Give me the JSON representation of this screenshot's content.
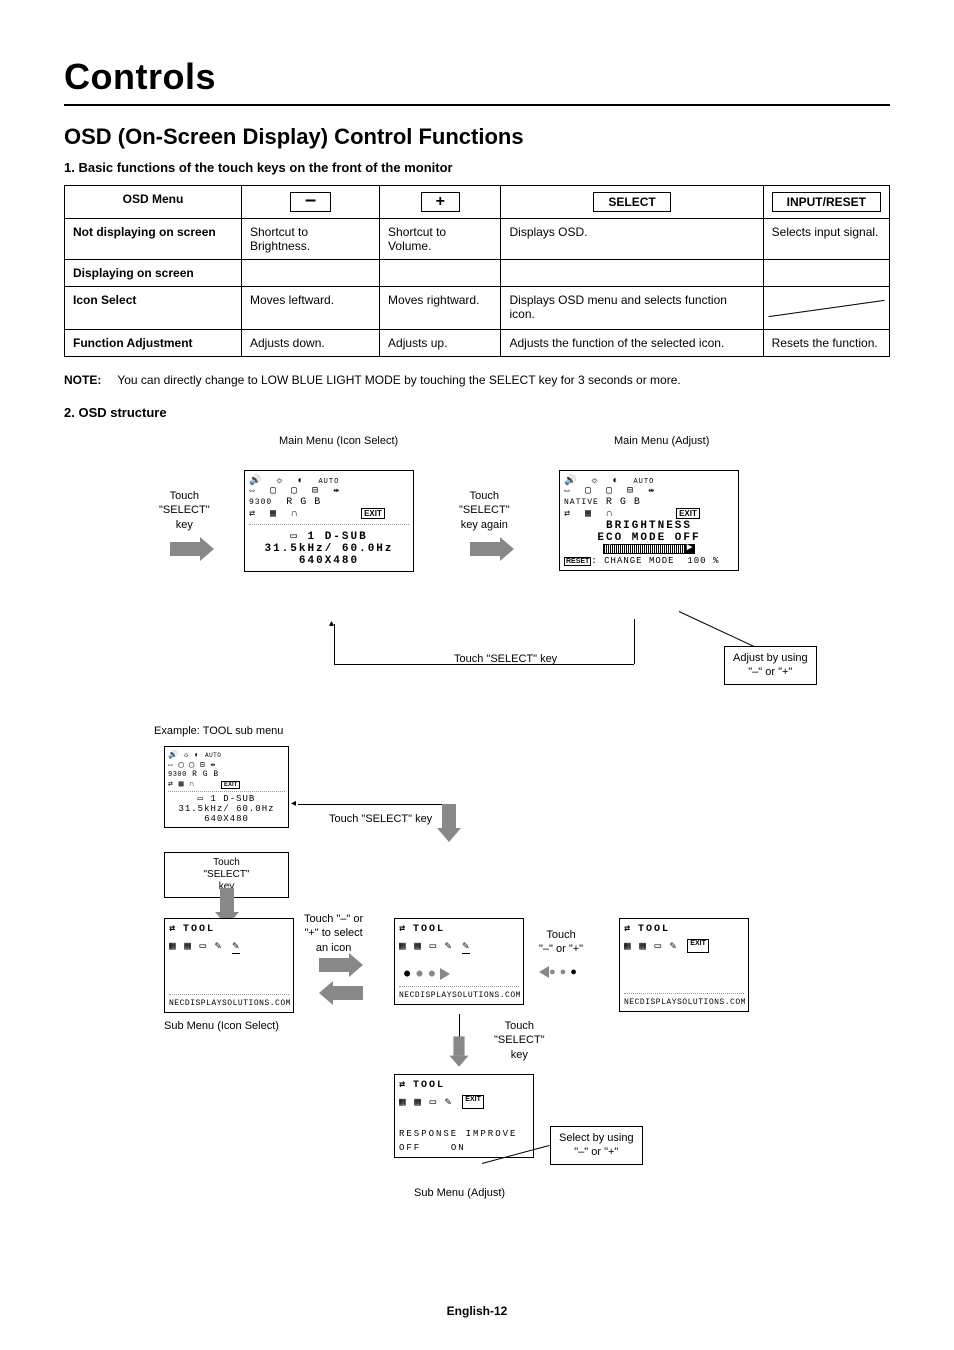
{
  "doc_title": "Controls",
  "section_title": "OSD (On-Screen Display) Control Functions",
  "sub1": "1. Basic functions of the touch keys on the front of the monitor",
  "table": {
    "headers": {
      "c0": "OSD Menu",
      "c1_sym": "–",
      "c2_sym": "+",
      "c3": "SELECT",
      "c4": "INPUT/RESET"
    },
    "rows": [
      {
        "head": "Not displaying on screen",
        "c1": "Shortcut to Brightness.",
        "c2": "Shortcut to Volume.",
        "c3": "Displays OSD.",
        "c4": "Selects input signal."
      },
      {
        "head": "Displaying on screen",
        "c1": "",
        "c2": "",
        "c3": "",
        "c4": ""
      },
      {
        "head": "Icon Select",
        "c1": "Moves leftward.",
        "c2": "Moves rightward.",
        "c3": "Displays OSD menu and selects function icon.",
        "c4": "__DIAGONAL__"
      },
      {
        "head": "Function Adjustment",
        "c1": "Adjusts down.",
        "c2": "Adjusts up.",
        "c3": "Adjusts the function of the selected icon.",
        "c4": "Resets the function."
      }
    ]
  },
  "note_label": "NOTE:",
  "note_text": "You can directly change to LOW BLUE LIGHT MODE by touching the SELECT key for 3 seconds or more.",
  "sub2": "2. OSD structure",
  "flow": {
    "main_menu_icon": "Main Menu (Icon Select)",
    "main_menu_adjust": "Main Menu (Adjust)",
    "touch_select_key": "Touch \"SELECT\" key",
    "touch_select_key_ml": "Touch\n\"SELECT\"\nkey",
    "touch_select_key_again": "Touch\n\"SELECT\"\nkey again",
    "adjust_by": "Adjust by using\n\"–\" or \"+\"",
    "example": "Example: TOOL sub menu",
    "touch_pm_select": "Touch \"–\" or\n\"+\" to select\nan icon",
    "touch_pm": "Touch\n\"–\" or \"+\"",
    "select_by": "Select by using\n\"–\" or \"+\"",
    "sub_menu_icon": "Sub Menu (Icon Select)",
    "sub_menu_adjust": "Sub Menu (Adjust)",
    "panel1": {
      "row3_l": "9300",
      "row3": "R   G   B",
      "info1": "1  D-SUB",
      "info2": "31.5kHz/ 60.0Hz",
      "info3": "640X480"
    },
    "panel2": {
      "row3_l": "NATIVE",
      "brightness": "BRIGHTNESS",
      "eco": "ECO MODE OFF",
      "reset": "RESET",
      "change": ": CHANGE MODE",
      "val": "100 %"
    },
    "tool": {
      "label": "TOOL",
      "url": "NECDISPLAYSOLUTIONS.COM",
      "resp": "RESPONSE IMPROVE",
      "off": "OFF",
      "on": "ON"
    }
  },
  "footer": "English-12"
}
